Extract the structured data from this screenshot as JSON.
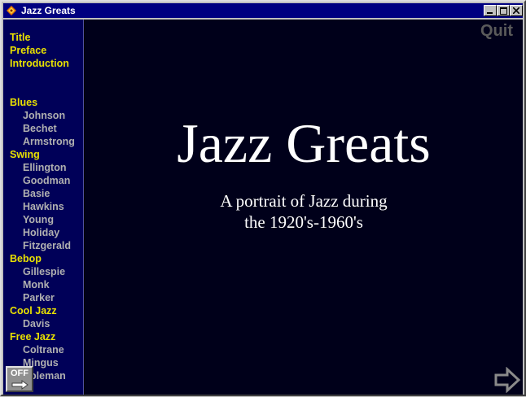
{
  "window": {
    "title": "Jazz Greats"
  },
  "sidebar": {
    "items": [
      {
        "label": "Title",
        "type": "heading"
      },
      {
        "label": "Preface",
        "type": "heading"
      },
      {
        "label": "Introduction",
        "type": "heading"
      },
      {
        "label": "Blues",
        "type": "heading"
      },
      {
        "label": "Johnson",
        "type": "sub"
      },
      {
        "label": "Bechet",
        "type": "sub"
      },
      {
        "label": "Armstrong",
        "type": "sub"
      },
      {
        "label": "Swing",
        "type": "heading"
      },
      {
        "label": "Ellington",
        "type": "sub"
      },
      {
        "label": "Goodman",
        "type": "sub"
      },
      {
        "label": "Basie",
        "type": "sub"
      },
      {
        "label": "Hawkins",
        "type": "sub"
      },
      {
        "label": "Young",
        "type": "sub"
      },
      {
        "label": "Holiday",
        "type": "sub"
      },
      {
        "label": "Fitzgerald",
        "type": "sub"
      },
      {
        "label": "Bebop",
        "type": "heading"
      },
      {
        "label": "Gillespie",
        "type": "sub"
      },
      {
        "label": "Monk",
        "type": "sub"
      },
      {
        "label": "Parker",
        "type": "sub"
      },
      {
        "label": "Cool Jazz",
        "type": "heading"
      },
      {
        "label": "Davis",
        "type": "sub"
      },
      {
        "label": "Free Jazz",
        "type": "heading"
      },
      {
        "label": "Coltrane",
        "type": "sub"
      },
      {
        "label": "Mingus",
        "type": "sub"
      },
      {
        "label": "Coleman",
        "type": "sub"
      }
    ]
  },
  "main": {
    "quit_label": "Quit",
    "title": "Jazz Greats",
    "subtitle_line1": "A portrait of Jazz during",
    "subtitle_line2": "the 1920's-1960's",
    "off_label": "OFF"
  },
  "colors": {
    "titlebar": "#000080",
    "sidebar_bg": "#000058",
    "heading_text": "#e8e000",
    "sub_text": "#b0b0b0",
    "main_bg": "#00001a"
  },
  "icons": {
    "app": "jazz-app-icon",
    "next": "arrow-right-icon",
    "off": "power-off-icon"
  }
}
